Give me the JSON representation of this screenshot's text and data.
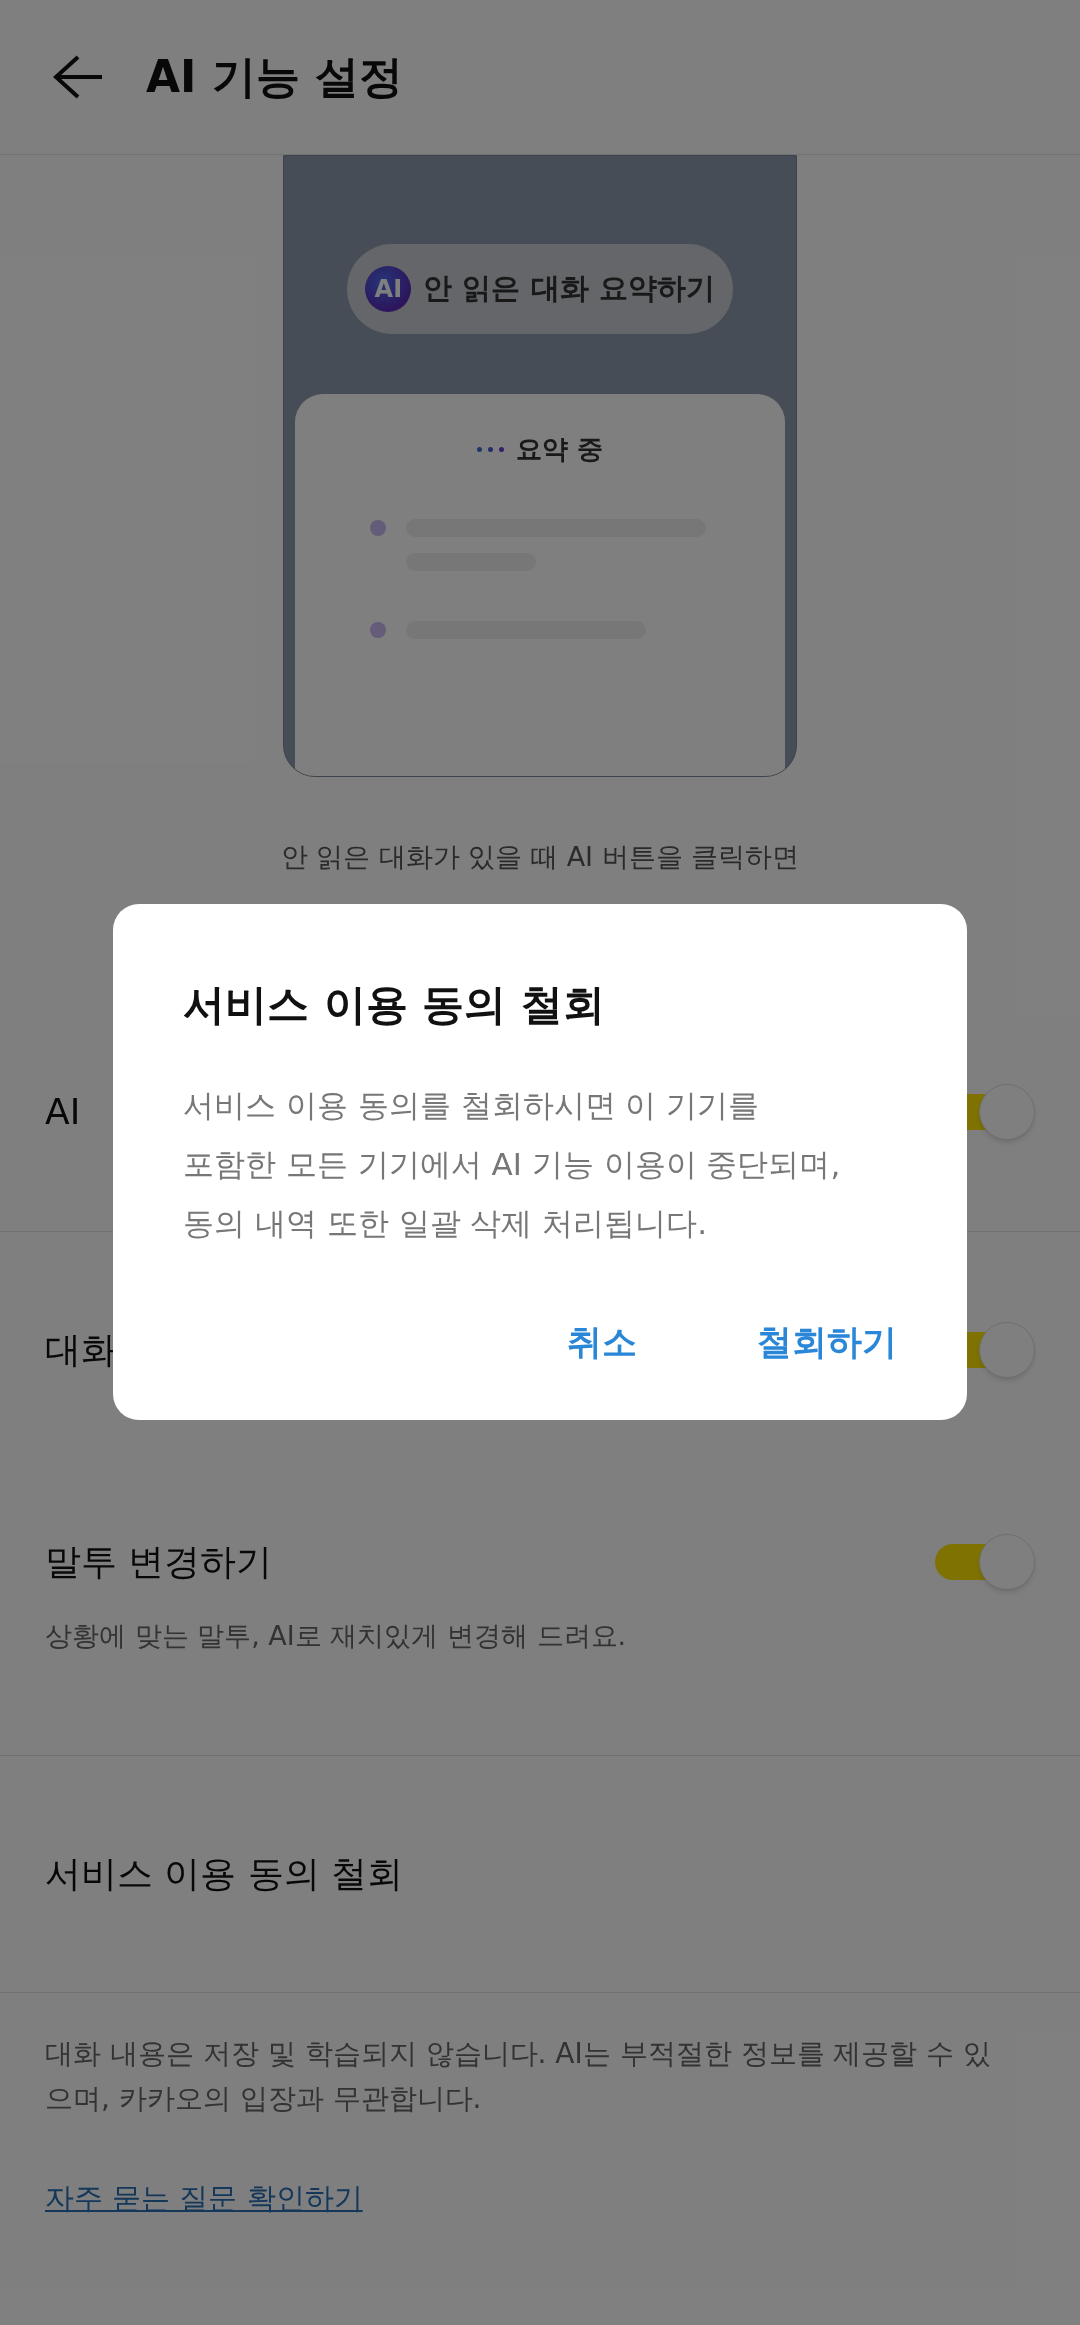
{
  "header": {
    "title": "AI 기능 설정"
  },
  "illustration": {
    "ai_badge": "AI",
    "button_label": "안 읽은 대화 요약하기",
    "card_title": "요약 중"
  },
  "caption": [
    "안 읽은 대화가 있을 때 AI 버튼을 클릭하면"
  ],
  "sections": [
    {
      "rows": [
        {
          "kind": "toggle",
          "title": "AI",
          "on": true
        }
      ]
    },
    {
      "rows": [
        {
          "kind": "toggle",
          "title": "대화",
          "on": true
        },
        {
          "kind": "toggle",
          "title": "말투 변경하기",
          "subtitle": "상황에 맞는 말투, AI로 재치있게 변경해 드려요.",
          "on": true
        }
      ]
    },
    {
      "rows": [
        {
          "kind": "action",
          "title": "서비스 이용 동의 철회"
        }
      ]
    }
  ],
  "disclaimer": "대화 내용은 저장 및 학습되지 않습니다. AI는 부적절한 정보를 제공할 수 있으며, 카카오의 입장과 무관합니다.",
  "faq_link": "자주 묻는 질문 확인하기",
  "dialog": {
    "title": "서비스 이용 동의 철회",
    "message": [
      "서비스 이용 동의를 철회하시면 이 기기를",
      "포함한 모든 기기에서 AI 기능 이용이 중단되며,",
      "동의 내역 또한 일괄 삭제 처리됩니다."
    ],
    "buttons": [
      "취소",
      "철회하기"
    ]
  }
}
